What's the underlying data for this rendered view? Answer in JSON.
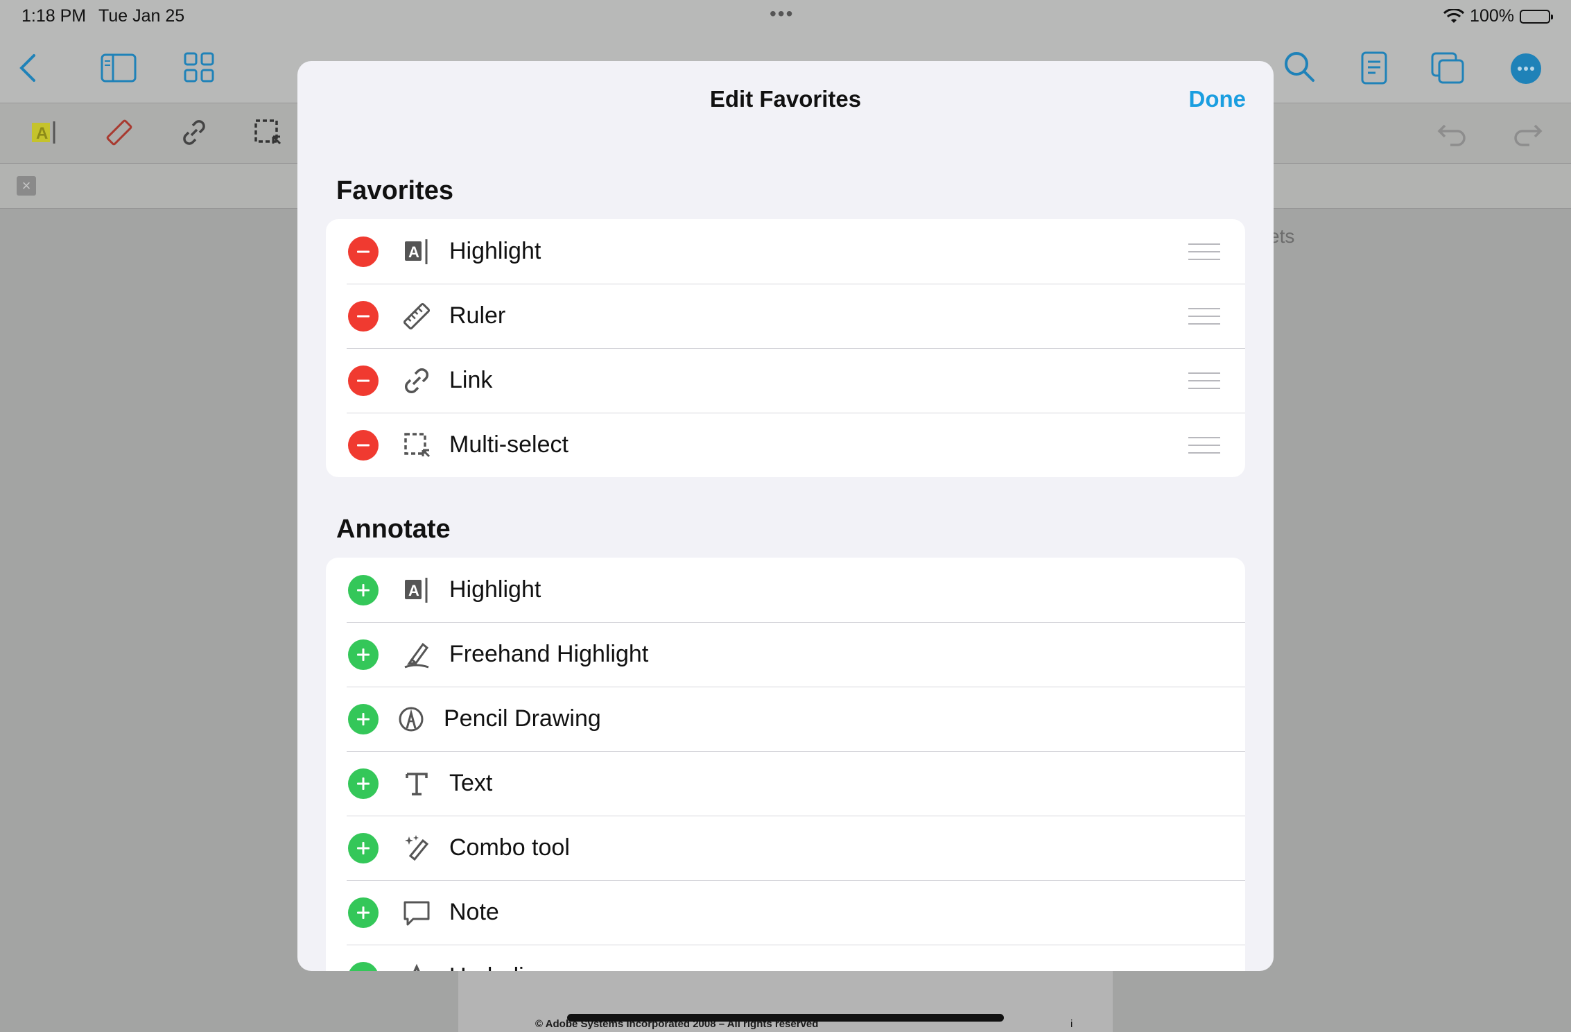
{
  "status": {
    "time": "1:18 PM",
    "date": "Tue Jan 25",
    "battery": "100%"
  },
  "background": {
    "partial_tab": "ets",
    "copyright": "© Adobe Systems Incorporated 2008 – All rights reserved",
    "page_marker": "i"
  },
  "sheet": {
    "title": "Edit Favorites",
    "done_label": "Done"
  },
  "favorites": {
    "header": "Favorites",
    "items": [
      {
        "label": "Highlight",
        "icon": "highlight-icon"
      },
      {
        "label": "Ruler",
        "icon": "ruler-icon"
      },
      {
        "label": "Link",
        "icon": "link-icon"
      },
      {
        "label": "Multi-select",
        "icon": "multi-select-icon"
      }
    ]
  },
  "annotate": {
    "header": "Annotate",
    "items": [
      {
        "label": "Highlight",
        "icon": "highlight-icon"
      },
      {
        "label": "Freehand Highlight",
        "icon": "freehand-highlight-icon"
      },
      {
        "label": "Pencil Drawing",
        "icon": "pencil-drawing-icon"
      },
      {
        "label": "Text",
        "icon": "text-icon"
      },
      {
        "label": "Combo tool",
        "icon": "combo-tool-icon"
      },
      {
        "label": "Note",
        "icon": "note-icon"
      },
      {
        "label": "Underline",
        "icon": "underline-icon"
      }
    ]
  },
  "colors": {
    "accent": "#1a9ee0",
    "remove": "#f03a30",
    "add": "#34c759"
  }
}
